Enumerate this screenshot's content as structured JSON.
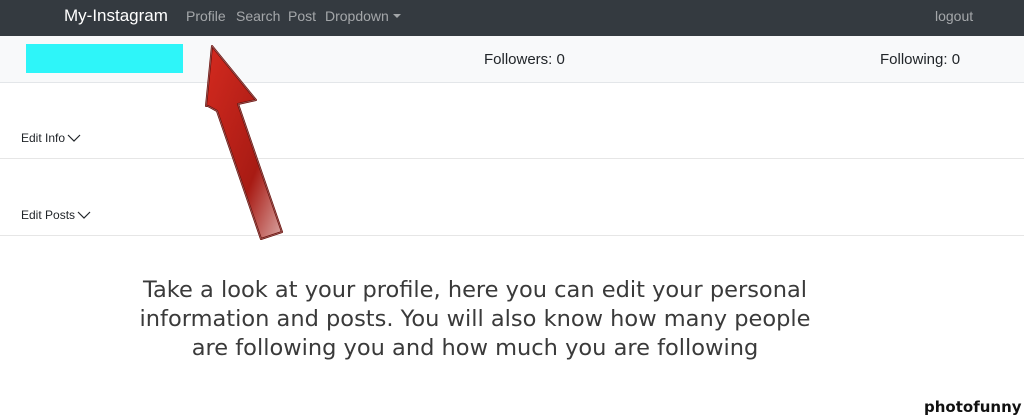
{
  "navbar": {
    "brand": "My-Instagram",
    "links": [
      "Profile",
      "Search",
      "Post"
    ],
    "dropdown_label": "Dropdown",
    "logout": "logout"
  },
  "stats": {
    "followers": "Followers: 0",
    "following": "Following: 0",
    "username_highlight_color": "#2ef5f9"
  },
  "sections": {
    "edit_info": "Edit Info",
    "edit_posts": "Edit Posts"
  },
  "annotation": {
    "arrow_color": "#c0211a",
    "caption": "Take a look at your profile, here you can edit your personal information and posts. You will also know how many people are following you and how much you are following"
  },
  "watermark": "photofunny"
}
